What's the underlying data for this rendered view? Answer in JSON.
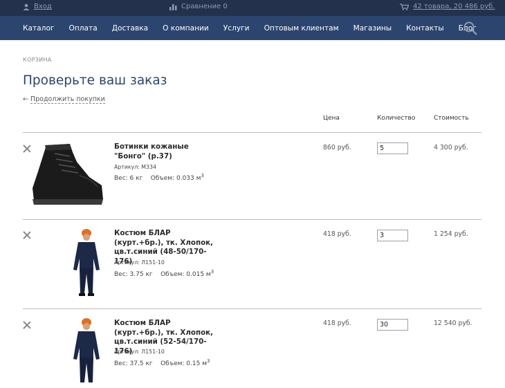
{
  "topbar": {
    "login": "Вход",
    "compare": "Сравнение 0",
    "cart": "42 товара, 20 486 руб."
  },
  "nav": {
    "items": [
      "Каталог",
      "Оплата",
      "Доставка",
      "О компании",
      "Услуги",
      "Оптовым клиентам",
      "Магазины",
      "Контакты",
      "Блог"
    ]
  },
  "breadcrumb": "КОРЗИНА",
  "page_title": "Проверьте ваш заказ",
  "continue_shopping": "Продолжить покупки",
  "table_headers": {
    "price": "Цена",
    "quantity": "Количество",
    "cost": "Стоимость"
  },
  "items": [
    {
      "name": "Ботинки кожаные \"Бонго\" (р.37)",
      "article": "Артикул: М334",
      "weight_label": "Вес: 6 кг",
      "volume_label": "Объем: 0.033 м",
      "volume_exp": "3",
      "price": "860 руб.",
      "quantity": "5",
      "cost": "4 300 руб."
    },
    {
      "name": "Костюм БЛАР (курт.+бр.), тк. Хлопок, цв.т.синий (48-50/170-176)",
      "article": "Артикул: Л151-10",
      "weight_label": "Вес: 3.75 кг",
      "volume_label": "Объем: 0.015 м",
      "volume_exp": "3",
      "price": "418 руб.",
      "quantity": "3",
      "cost": "1 254 руб."
    },
    {
      "name": "Костюм БЛАР (курт.+бр.), тк. Хлопок, цв.т.синий (52-54/170-176)",
      "article": "Артикул: Л151-10",
      "weight_label": "Вес: 37.5 кг",
      "volume_label": "Объем: 0.15 м",
      "volume_exp": "3",
      "price": "418 руб.",
      "quantity": "30",
      "cost": "12 540 руб."
    }
  ],
  "colors": {
    "topbar": "#23314d",
    "nav": "#2b456e",
    "title": "#2b456e"
  }
}
